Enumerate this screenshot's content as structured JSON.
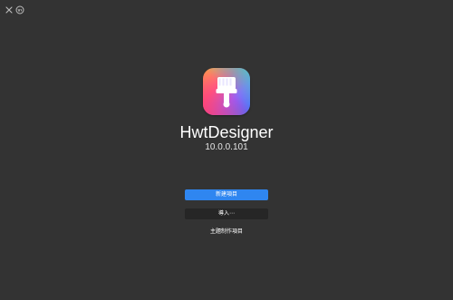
{
  "window": {
    "close_icon": "close-icon",
    "badge_icon": "version-badge-icon"
  },
  "app": {
    "icon": "paintbrush-app-icon",
    "name": "HwtDesigner",
    "version": "10.0.0.101"
  },
  "actions": {
    "new_project": "新建項目",
    "import": "導入⋯",
    "theme_project": "主題制作項目"
  },
  "colors": {
    "background": "#333333",
    "primary_button": "#2f86f0",
    "secondary_button": "#262626",
    "logo_gradient": [
      "#ffb347",
      "#ff5e7e",
      "#b05cff",
      "#4b7bff",
      "#34d9c4",
      "#7be06a"
    ]
  }
}
